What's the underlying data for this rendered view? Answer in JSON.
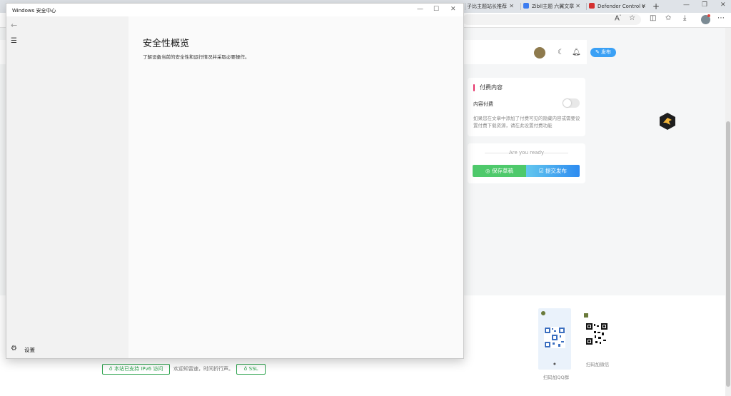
{
  "browser": {
    "tabs": [
      {
        "label": "子比主题站长推荐",
        "color": "#f0a020"
      },
      {
        "label": "Zibll主题 六翼文章",
        "color": "#3b7cf0"
      },
      {
        "label": "Defender Control v",
        "color": "#d43030"
      }
    ],
    "tab_close": "✕",
    "new_tab": "+"
  },
  "site": {
    "publish_label": "发布",
    "paid": {
      "title": "付费内容",
      "toggle_label": "内容付费",
      "toggle_on": false,
      "description": "如果您在文章中添加了付费可见的隐藏内容或需要设置付费下载资源，请在此设置付费功能"
    },
    "ready": {
      "text": "Are you ready",
      "draft_label": "保存草稿",
      "submit_label": "提交发布"
    },
    "footer": {
      "ipv6_badge": "本站已支持 IPv6 访问",
      "tagline": "欢迎知雷速，时间折行声。",
      "ssl_badge": "SSL",
      "qq_label": "扫码加QQ群",
      "wechat_label": "扫码加微信"
    }
  },
  "winsec": {
    "window_title": "Windows 安全中心",
    "heading": "安全性概览",
    "subtitle": "了解设备当前的安全性和运行情况并采取必要操作。",
    "settings_label": "设置"
  },
  "colors": {
    "accent_blue": "#3aa0f5",
    "draft_green": "#4ec96b",
    "submit_blue": "#2d8bf0",
    "paid_bar": "#e6336a",
    "badge_green": "#2ba24c"
  }
}
